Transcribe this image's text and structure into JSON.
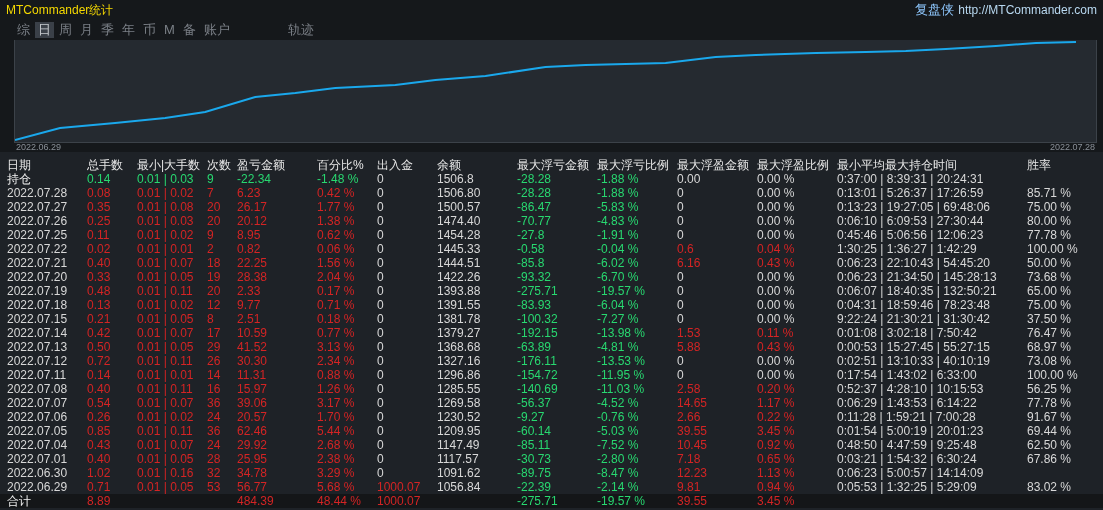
{
  "window": {
    "title": "MTCommander统计",
    "brand": "复盘侠",
    "link": "http://MTCommander.com"
  },
  "tabs": [
    {
      "label": "综",
      "selected": false
    },
    {
      "label": "日",
      "selected": true
    },
    {
      "label": "周",
      "selected": false
    },
    {
      "label": "月",
      "selected": false
    },
    {
      "label": "季",
      "selected": false
    },
    {
      "label": "年",
      "selected": false
    },
    {
      "label": "币",
      "selected": false
    },
    {
      "label": "M",
      "selected": false
    },
    {
      "label": "备",
      "selected": false
    },
    {
      "label": "账户",
      "selected": false
    },
    {
      "label": "轨迹",
      "selected": false
    }
  ],
  "chart": {
    "start_label": "2022.06.29",
    "end_label": "2022.07.28"
  },
  "table": {
    "columns": [
      "日期",
      "总手数",
      "最小|大手数",
      "次数",
      "盈亏金额",
      "百分比%",
      "出入金",
      "余额",
      "最大浮亏金额",
      "最大浮亏比例",
      "最大浮盈金额",
      "最大浮盈比例",
      "最小平均最大持仓时间",
      "胜率"
    ],
    "rows": [
      {
        "kind": "position",
        "cells": [
          {
            "text": "持仓"
          },
          {
            "text": "0.14",
            "color": "#28d870"
          },
          {
            "text": "0.01 | 0.03",
            "color": "#28d870"
          },
          {
            "text": "9",
            "color": "#28d870"
          },
          {
            "text": "-22.34",
            "color": "#28d870"
          },
          {
            "text": "-1.48 %",
            "color": "#28d870"
          },
          {
            "text": "0",
            "color": "#d8d8d8"
          },
          {
            "text": "1506.8",
            "color": "#d8d8d8"
          },
          {
            "text": "-28.28",
            "color": "#28d870"
          },
          {
            "text": "-1.88 %",
            "color": "#28d870"
          },
          {
            "text": "0.00",
            "color": "#d8d8d8"
          },
          {
            "text": "0.00 %",
            "color": "#d8d8d8"
          },
          {
            "text": "0:37:00 | 8:39:31 | 20:24:31",
            "color": "#d8d8d8"
          },
          {
            "text": ""
          }
        ]
      },
      {
        "kind": "day",
        "cells": [
          {
            "text": "2022.07.28",
            "color": "#d8d8d8"
          },
          {
            "text": "0.08",
            "color": "#d42424"
          },
          {
            "text": "0.01 | 0.02",
            "color": "#d42424"
          },
          {
            "text": "7",
            "color": "#d42424"
          },
          {
            "text": "6.23",
            "color": "#d42424"
          },
          {
            "text": "0.42 %",
            "color": "#d42424"
          },
          {
            "text": "0",
            "color": "#d8d8d8"
          },
          {
            "text": "1506.80",
            "color": "#d8d8d8"
          },
          {
            "text": "-28.28",
            "color": "#28d870"
          },
          {
            "text": "-1.88 %",
            "color": "#28d870"
          },
          {
            "text": "0",
            "color": "#d8d8d8"
          },
          {
            "text": "0.00 %",
            "color": "#d8d8d8"
          },
          {
            "text": "0:13:01 | 5:26:37 | 17:26:59",
            "color": "#d8d8d8"
          },
          {
            "text": "85.71 %",
            "color": "#d8d8d8"
          }
        ]
      },
      {
        "kind": "day",
        "cells": [
          {
            "text": "2022.07.27",
            "color": "#d8d8d8"
          },
          {
            "text": "0.35",
            "color": "#d42424"
          },
          {
            "text": "0.01 | 0.08",
            "color": "#d42424"
          },
          {
            "text": "20",
            "color": "#d42424"
          },
          {
            "text": "26.17",
            "color": "#d42424"
          },
          {
            "text": "1.77 %",
            "color": "#d42424"
          },
          {
            "text": "0",
            "color": "#d8d8d8"
          },
          {
            "text": "1500.57",
            "color": "#d8d8d8"
          },
          {
            "text": "-86.47",
            "color": "#28d870"
          },
          {
            "text": "-5.83 %",
            "color": "#28d870"
          },
          {
            "text": "0",
            "color": "#d8d8d8"
          },
          {
            "text": "0.00 %",
            "color": "#d8d8d8"
          },
          {
            "text": "0:13:23 | 19:27:05 | 69:48:06",
            "color": "#d8d8d8"
          },
          {
            "text": "75.00 %",
            "color": "#d8d8d8"
          }
        ]
      },
      {
        "kind": "day",
        "cells": [
          {
            "text": "2022.07.26",
            "color": "#d8d8d8"
          },
          {
            "text": "0.25",
            "color": "#d42424"
          },
          {
            "text": "0.01 | 0.03",
            "color": "#d42424"
          },
          {
            "text": "20",
            "color": "#d42424"
          },
          {
            "text": "20.12",
            "color": "#d42424"
          },
          {
            "text": "1.38 %",
            "color": "#d42424"
          },
          {
            "text": "0",
            "color": "#d8d8d8"
          },
          {
            "text": "1474.40",
            "color": "#d8d8d8"
          },
          {
            "text": "-70.77",
            "color": "#28d870"
          },
          {
            "text": "-4.83 %",
            "color": "#28d870"
          },
          {
            "text": "0",
            "color": "#d8d8d8"
          },
          {
            "text": "0.00 %",
            "color": "#d8d8d8"
          },
          {
            "text": "0:06:10 | 6:09:53 | 27:30:44",
            "color": "#d8d8d8"
          },
          {
            "text": "80.00 %",
            "color": "#d8d8d8"
          }
        ]
      },
      {
        "kind": "day",
        "cells": [
          {
            "text": "2022.07.25",
            "color": "#d8d8d8"
          },
          {
            "text": "0.11",
            "color": "#d42424"
          },
          {
            "text": "0.01 | 0.02",
            "color": "#d42424"
          },
          {
            "text": "9",
            "color": "#d42424"
          },
          {
            "text": "8.95",
            "color": "#d42424"
          },
          {
            "text": "0.62 %",
            "color": "#d42424"
          },
          {
            "text": "0",
            "color": "#d8d8d8"
          },
          {
            "text": "1454.28",
            "color": "#d8d8d8"
          },
          {
            "text": "-27.8",
            "color": "#28d870"
          },
          {
            "text": "-1.91 %",
            "color": "#28d870"
          },
          {
            "text": "0",
            "color": "#d8d8d8"
          },
          {
            "text": "0.00 %",
            "color": "#d8d8d8"
          },
          {
            "text": "0:45:46 | 5:06:56 | 12:06:23",
            "color": "#d8d8d8"
          },
          {
            "text": "77.78 %",
            "color": "#d8d8d8"
          }
        ]
      },
      {
        "kind": "day",
        "cells": [
          {
            "text": "2022.07.22",
            "color": "#d8d8d8"
          },
          {
            "text": "0.02",
            "color": "#d42424"
          },
          {
            "text": "0.01 | 0.01",
            "color": "#d42424"
          },
          {
            "text": "2",
            "color": "#d42424"
          },
          {
            "text": "0.82",
            "color": "#d42424"
          },
          {
            "text": "0.06 %",
            "color": "#d42424"
          },
          {
            "text": "0",
            "color": "#d8d8d8"
          },
          {
            "text": "1445.33",
            "color": "#d8d8d8"
          },
          {
            "text": "-0.58",
            "color": "#28d870"
          },
          {
            "text": "-0.04 %",
            "color": "#28d870"
          },
          {
            "text": "0.6",
            "color": "#d42424"
          },
          {
            "text": "0.04 %",
            "color": "#d42424"
          },
          {
            "text": "1:30:25 | 1:36:27 | 1:42:29",
            "color": "#d8d8d8"
          },
          {
            "text": "100.00 %",
            "color": "#d8d8d8"
          }
        ]
      },
      {
        "kind": "day",
        "cells": [
          {
            "text": "2022.07.21",
            "color": "#d8d8d8"
          },
          {
            "text": "0.40",
            "color": "#d42424"
          },
          {
            "text": "0.01 | 0.07",
            "color": "#d42424"
          },
          {
            "text": "18",
            "color": "#d42424"
          },
          {
            "text": "22.25",
            "color": "#d42424"
          },
          {
            "text": "1.56 %",
            "color": "#d42424"
          },
          {
            "text": "0",
            "color": "#d8d8d8"
          },
          {
            "text": "1444.51",
            "color": "#d8d8d8"
          },
          {
            "text": "-85.8",
            "color": "#28d870"
          },
          {
            "text": "-6.02 %",
            "color": "#28d870"
          },
          {
            "text": "6.16",
            "color": "#d42424"
          },
          {
            "text": "0.43 %",
            "color": "#d42424"
          },
          {
            "text": "0:06:23 | 22:10:43 | 54:45:20",
            "color": "#d8d8d8"
          },
          {
            "text": "50.00 %",
            "color": "#d8d8d8"
          }
        ]
      },
      {
        "kind": "day",
        "cells": [
          {
            "text": "2022.07.20",
            "color": "#d8d8d8"
          },
          {
            "text": "0.33",
            "color": "#d42424"
          },
          {
            "text": "0.01 | 0.05",
            "color": "#d42424"
          },
          {
            "text": "19",
            "color": "#d42424"
          },
          {
            "text": "28.38",
            "color": "#d42424"
          },
          {
            "text": "2.04 %",
            "color": "#d42424"
          },
          {
            "text": "0",
            "color": "#d8d8d8"
          },
          {
            "text": "1422.26",
            "color": "#d8d8d8"
          },
          {
            "text": "-93.32",
            "color": "#28d870"
          },
          {
            "text": "-6.70 %",
            "color": "#28d870"
          },
          {
            "text": "0",
            "color": "#d8d8d8"
          },
          {
            "text": "0.00 %",
            "color": "#d8d8d8"
          },
          {
            "text": "0:06:23 | 21:34:50 | 145:28:13",
            "color": "#d8d8d8"
          },
          {
            "text": "73.68 %",
            "color": "#d8d8d8"
          }
        ]
      },
      {
        "kind": "day",
        "cells": [
          {
            "text": "2022.07.19",
            "color": "#d8d8d8"
          },
          {
            "text": "0.48",
            "color": "#d42424"
          },
          {
            "text": "0.01 | 0.11",
            "color": "#d42424"
          },
          {
            "text": "20",
            "color": "#d42424"
          },
          {
            "text": "2.33",
            "color": "#d42424"
          },
          {
            "text": "0.17 %",
            "color": "#d42424"
          },
          {
            "text": "0",
            "color": "#d8d8d8"
          },
          {
            "text": "1393.88",
            "color": "#d8d8d8"
          },
          {
            "text": "-275.71",
            "color": "#28d870"
          },
          {
            "text": "-19.57 %",
            "color": "#28d870"
          },
          {
            "text": "0",
            "color": "#d8d8d8"
          },
          {
            "text": "0.00 %",
            "color": "#d8d8d8"
          },
          {
            "text": "0:06:07 | 18:40:35 | 132:50:21",
            "color": "#d8d8d8"
          },
          {
            "text": "65.00 %",
            "color": "#d8d8d8"
          }
        ]
      },
      {
        "kind": "day",
        "cells": [
          {
            "text": "2022.07.18",
            "color": "#d8d8d8"
          },
          {
            "text": "0.13",
            "color": "#d42424"
          },
          {
            "text": "0.01 | 0.02",
            "color": "#d42424"
          },
          {
            "text": "12",
            "color": "#d42424"
          },
          {
            "text": "9.77",
            "color": "#d42424"
          },
          {
            "text": "0.71 %",
            "color": "#d42424"
          },
          {
            "text": "0",
            "color": "#d8d8d8"
          },
          {
            "text": "1391.55",
            "color": "#d8d8d8"
          },
          {
            "text": "-83.93",
            "color": "#28d870"
          },
          {
            "text": "-6.04 %",
            "color": "#28d870"
          },
          {
            "text": "0",
            "color": "#d8d8d8"
          },
          {
            "text": "0.00 %",
            "color": "#d8d8d8"
          },
          {
            "text": "0:04:31 | 18:59:46 | 78:23:48",
            "color": "#d8d8d8"
          },
          {
            "text": "75.00 %",
            "color": "#d8d8d8"
          }
        ]
      },
      {
        "kind": "day",
        "cells": [
          {
            "text": "2022.07.15",
            "color": "#d8d8d8"
          },
          {
            "text": "0.21",
            "color": "#d42424"
          },
          {
            "text": "0.01 | 0.05",
            "color": "#d42424"
          },
          {
            "text": "8",
            "color": "#d42424"
          },
          {
            "text": "2.51",
            "color": "#d42424"
          },
          {
            "text": "0.18 %",
            "color": "#d42424"
          },
          {
            "text": "0",
            "color": "#d8d8d8"
          },
          {
            "text": "1381.78",
            "color": "#d8d8d8"
          },
          {
            "text": "-100.32",
            "color": "#28d870"
          },
          {
            "text": "-7.27 %",
            "color": "#28d870"
          },
          {
            "text": "0",
            "color": "#d8d8d8"
          },
          {
            "text": "0.00 %",
            "color": "#d8d8d8"
          },
          {
            "text": "9:22:24 | 21:30:21 | 31:30:42",
            "color": "#d8d8d8"
          },
          {
            "text": "37.50 %",
            "color": "#d8d8d8"
          }
        ]
      },
      {
        "kind": "day",
        "cells": [
          {
            "text": "2022.07.14",
            "color": "#d8d8d8"
          },
          {
            "text": "0.42",
            "color": "#d42424"
          },
          {
            "text": "0.01 | 0.07",
            "color": "#d42424"
          },
          {
            "text": "17",
            "color": "#d42424"
          },
          {
            "text": "10.59",
            "color": "#d42424"
          },
          {
            "text": "0.77 %",
            "color": "#d42424"
          },
          {
            "text": "0",
            "color": "#d8d8d8"
          },
          {
            "text": "1379.27",
            "color": "#d8d8d8"
          },
          {
            "text": "-192.15",
            "color": "#28d870"
          },
          {
            "text": "-13.98 %",
            "color": "#28d870"
          },
          {
            "text": "1.53",
            "color": "#d42424"
          },
          {
            "text": "0.11 %",
            "color": "#d42424"
          },
          {
            "text": "0:01:08 | 3:02:18 | 7:50:42",
            "color": "#d8d8d8"
          },
          {
            "text": "76.47 %",
            "color": "#d8d8d8"
          }
        ]
      },
      {
        "kind": "day",
        "cells": [
          {
            "text": "2022.07.13",
            "color": "#d8d8d8"
          },
          {
            "text": "0.50",
            "color": "#d42424"
          },
          {
            "text": "0.01 | 0.05",
            "color": "#d42424"
          },
          {
            "text": "29",
            "color": "#d42424"
          },
          {
            "text": "41.52",
            "color": "#d42424"
          },
          {
            "text": "3.13 %",
            "color": "#d42424"
          },
          {
            "text": "0",
            "color": "#d8d8d8"
          },
          {
            "text": "1368.68",
            "color": "#d8d8d8"
          },
          {
            "text": "-63.89",
            "color": "#28d870"
          },
          {
            "text": "-4.81 %",
            "color": "#28d870"
          },
          {
            "text": "5.88",
            "color": "#d42424"
          },
          {
            "text": "0.43 %",
            "color": "#d42424"
          },
          {
            "text": "0:00:53 | 15:27:45 | 55:27:15",
            "color": "#d8d8d8"
          },
          {
            "text": "68.97 %",
            "color": "#d8d8d8"
          }
        ]
      },
      {
        "kind": "day",
        "cells": [
          {
            "text": "2022.07.12",
            "color": "#d8d8d8"
          },
          {
            "text": "0.72",
            "color": "#d42424"
          },
          {
            "text": "0.01 | 0.11",
            "color": "#d42424"
          },
          {
            "text": "26",
            "color": "#d42424"
          },
          {
            "text": "30.30",
            "color": "#d42424"
          },
          {
            "text": "2.34 %",
            "color": "#d42424"
          },
          {
            "text": "0",
            "color": "#d8d8d8"
          },
          {
            "text": "1327.16",
            "color": "#d8d8d8"
          },
          {
            "text": "-176.11",
            "color": "#28d870"
          },
          {
            "text": "-13.53 %",
            "color": "#28d870"
          },
          {
            "text": "0",
            "color": "#d8d8d8"
          },
          {
            "text": "0.00 %",
            "color": "#d8d8d8"
          },
          {
            "text": "0:02:51 | 13:10:33 | 40:10:19",
            "color": "#d8d8d8"
          },
          {
            "text": "73.08 %",
            "color": "#d8d8d8"
          }
        ]
      },
      {
        "kind": "day",
        "cells": [
          {
            "text": "2022.07.11",
            "color": "#d8d8d8"
          },
          {
            "text": "0.14",
            "color": "#d42424"
          },
          {
            "text": "0.01 | 0.01",
            "color": "#d42424"
          },
          {
            "text": "14",
            "color": "#d42424"
          },
          {
            "text": "11.31",
            "color": "#d42424"
          },
          {
            "text": "0.88 %",
            "color": "#d42424"
          },
          {
            "text": "0",
            "color": "#d8d8d8"
          },
          {
            "text": "1296.86",
            "color": "#d8d8d8"
          },
          {
            "text": "-154.72",
            "color": "#28d870"
          },
          {
            "text": "-11.95 %",
            "color": "#28d870"
          },
          {
            "text": "0",
            "color": "#d8d8d8"
          },
          {
            "text": "0.00 %",
            "color": "#d8d8d8"
          },
          {
            "text": "0:17:54 | 1:43:02 | 6:33:00",
            "color": "#d8d8d8"
          },
          {
            "text": "100.00 %",
            "color": "#d8d8d8"
          }
        ]
      },
      {
        "kind": "day",
        "cells": [
          {
            "text": "2022.07.08",
            "color": "#d8d8d8"
          },
          {
            "text": "0.40",
            "color": "#d42424"
          },
          {
            "text": "0.01 | 0.11",
            "color": "#d42424"
          },
          {
            "text": "16",
            "color": "#d42424"
          },
          {
            "text": "15.97",
            "color": "#d42424"
          },
          {
            "text": "1.26 %",
            "color": "#d42424"
          },
          {
            "text": "0",
            "color": "#d8d8d8"
          },
          {
            "text": "1285.55",
            "color": "#d8d8d8"
          },
          {
            "text": "-140.69",
            "color": "#28d870"
          },
          {
            "text": "-11.03 %",
            "color": "#28d870"
          },
          {
            "text": "2.58",
            "color": "#d42424"
          },
          {
            "text": "0.20 %",
            "color": "#d42424"
          },
          {
            "text": "0:52:37 | 4:28:10 | 10:15:53",
            "color": "#d8d8d8"
          },
          {
            "text": "56.25 %",
            "color": "#d8d8d8"
          }
        ]
      },
      {
        "kind": "day",
        "cells": [
          {
            "text": "2022.07.07",
            "color": "#d8d8d8"
          },
          {
            "text": "0.54",
            "color": "#d42424"
          },
          {
            "text": "0.01 | 0.07",
            "color": "#d42424"
          },
          {
            "text": "36",
            "color": "#d42424"
          },
          {
            "text": "39.06",
            "color": "#d42424"
          },
          {
            "text": "3.17 %",
            "color": "#d42424"
          },
          {
            "text": "0",
            "color": "#d8d8d8"
          },
          {
            "text": "1269.58",
            "color": "#d8d8d8"
          },
          {
            "text": "-56.37",
            "color": "#28d870"
          },
          {
            "text": "-4.52 %",
            "color": "#28d870"
          },
          {
            "text": "14.65",
            "color": "#d42424"
          },
          {
            "text": "1.17 %",
            "color": "#d42424"
          },
          {
            "text": "0:06:29 | 1:43:53 | 6:14:22",
            "color": "#d8d8d8"
          },
          {
            "text": "77.78 %",
            "color": "#d8d8d8"
          }
        ]
      },
      {
        "kind": "day",
        "cells": [
          {
            "text": "2022.07.06",
            "color": "#d8d8d8"
          },
          {
            "text": "0.26",
            "color": "#d42424"
          },
          {
            "text": "0.01 | 0.02",
            "color": "#d42424"
          },
          {
            "text": "24",
            "color": "#d42424"
          },
          {
            "text": "20.57",
            "color": "#d42424"
          },
          {
            "text": "1.70 %",
            "color": "#d42424"
          },
          {
            "text": "0",
            "color": "#d8d8d8"
          },
          {
            "text": "1230.52",
            "color": "#d8d8d8"
          },
          {
            "text": "-9.27",
            "color": "#28d870"
          },
          {
            "text": "-0.76 %",
            "color": "#28d870"
          },
          {
            "text": "2.66",
            "color": "#d42424"
          },
          {
            "text": "0.22 %",
            "color": "#d42424"
          },
          {
            "text": "0:11:28 | 1:59:21 | 7:00:28",
            "color": "#d8d8d8"
          },
          {
            "text": "91.67 %",
            "color": "#d8d8d8"
          }
        ]
      },
      {
        "kind": "day",
        "cells": [
          {
            "text": "2022.07.05",
            "color": "#d8d8d8"
          },
          {
            "text": "0.85",
            "color": "#d42424"
          },
          {
            "text": "0.01 | 0.11",
            "color": "#d42424"
          },
          {
            "text": "36",
            "color": "#d42424"
          },
          {
            "text": "62.46",
            "color": "#d42424"
          },
          {
            "text": "5.44 %",
            "color": "#d42424"
          },
          {
            "text": "0",
            "color": "#d8d8d8"
          },
          {
            "text": "1209.95",
            "color": "#d8d8d8"
          },
          {
            "text": "-60.14",
            "color": "#28d870"
          },
          {
            "text": "-5.03 %",
            "color": "#28d870"
          },
          {
            "text": "39.55",
            "color": "#d42424"
          },
          {
            "text": "3.45 %",
            "color": "#d42424"
          },
          {
            "text": "0:01:54 | 5:00:19 | 20:01:23",
            "color": "#d8d8d8"
          },
          {
            "text": "69.44 %",
            "color": "#d8d8d8"
          }
        ]
      },
      {
        "kind": "day",
        "cells": [
          {
            "text": "2022.07.04",
            "color": "#d8d8d8"
          },
          {
            "text": "0.43",
            "color": "#d42424"
          },
          {
            "text": "0.01 | 0.07",
            "color": "#d42424"
          },
          {
            "text": "24",
            "color": "#d42424"
          },
          {
            "text": "29.92",
            "color": "#d42424"
          },
          {
            "text": "2.68 %",
            "color": "#d42424"
          },
          {
            "text": "0",
            "color": "#d8d8d8"
          },
          {
            "text": "1147.49",
            "color": "#d8d8d8"
          },
          {
            "text": "-85.11",
            "color": "#28d870"
          },
          {
            "text": "-7.52 %",
            "color": "#28d870"
          },
          {
            "text": "10.45",
            "color": "#d42424"
          },
          {
            "text": "0.92 %",
            "color": "#d42424"
          },
          {
            "text": "0:48:50 | 4:47:59 | 9:25:48",
            "color": "#d8d8d8"
          },
          {
            "text": "62.50 %",
            "color": "#d8d8d8"
          }
        ]
      },
      {
        "kind": "day",
        "cells": [
          {
            "text": "2022.07.01",
            "color": "#d8d8d8"
          },
          {
            "text": "0.40",
            "color": "#d42424"
          },
          {
            "text": "0.01 | 0.05",
            "color": "#d42424"
          },
          {
            "text": "28",
            "color": "#d42424"
          },
          {
            "text": "25.95",
            "color": "#d42424"
          },
          {
            "text": "2.38 %",
            "color": "#d42424"
          },
          {
            "text": "0",
            "color": "#d8d8d8"
          },
          {
            "text": "1117.57",
            "color": "#d8d8d8"
          },
          {
            "text": "-30.73",
            "color": "#28d870"
          },
          {
            "text": "-2.80 %",
            "color": "#28d870"
          },
          {
            "text": "7.18",
            "color": "#d42424"
          },
          {
            "text": "0.65 %",
            "color": "#d42424"
          },
          {
            "text": "0:03:21 | 1:54:32 | 6:30:24",
            "color": "#d8d8d8"
          },
          {
            "text": "67.86 %",
            "color": "#d8d8d8"
          }
        ]
      },
      {
        "kind": "day",
        "cells": [
          {
            "text": "2022.06.30",
            "color": "#d8d8d8"
          },
          {
            "text": "1.02",
            "color": "#d42424"
          },
          {
            "text": "0.01 | 0.16",
            "color": "#d42424"
          },
          {
            "text": "32",
            "color": "#d42424"
          },
          {
            "text": "34.78",
            "color": "#d42424"
          },
          {
            "text": "3.29 %",
            "color": "#d42424"
          },
          {
            "text": "0",
            "color": "#d8d8d8"
          },
          {
            "text": "1091.62",
            "color": "#d8d8d8"
          },
          {
            "text": "-89.75",
            "color": "#28d870"
          },
          {
            "text": "-8.47 %",
            "color": "#28d870"
          },
          {
            "text": "12.23",
            "color": "#d42424"
          },
          {
            "text": "1.13 %",
            "color": "#d42424"
          },
          {
            "text": "0:06:23 | 5:00:57 | 14:14:09",
            "color": "#d8d8d8"
          },
          {
            "text": ""
          }
        ]
      },
      {
        "kind": "day",
        "cells": [
          {
            "text": "2022.06.29",
            "color": "#d8d8d8"
          },
          {
            "text": "0.71",
            "color": "#d42424"
          },
          {
            "text": "0.01 | 0.05",
            "color": "#d42424"
          },
          {
            "text": "53",
            "color": "#d42424"
          },
          {
            "text": "56.77",
            "color": "#d42424"
          },
          {
            "text": "5.68 %",
            "color": "#d42424"
          },
          {
            "text": "1000.07",
            "color": "#d42424"
          },
          {
            "text": "1056.84",
            "color": "#d8d8d8"
          },
          {
            "text": "-22.39",
            "color": "#28d870"
          },
          {
            "text": "-2.14 %",
            "color": "#28d870"
          },
          {
            "text": "9.81",
            "color": "#d42424"
          },
          {
            "text": "0.94 %",
            "color": "#d42424"
          },
          {
            "text": "0:05:53 | 1:32:25 | 5:29:09",
            "color": "#d8d8d8"
          },
          {
            "text": "83.02 %",
            "color": "#d8d8d8"
          }
        ]
      },
      {
        "kind": "total",
        "cells": [
          {
            "text": "合计"
          },
          {
            "text": "8.89",
            "color": "#d42424"
          },
          {
            "text": ""
          },
          {
            "text": ""
          },
          {
            "text": "484.39",
            "color": "#d42424"
          },
          {
            "text": "48.44 %",
            "color": "#d42424"
          },
          {
            "text": "1000.07",
            "color": "#d42424"
          },
          {
            "text": ""
          },
          {
            "text": "-275.71",
            "color": "#28d870"
          },
          {
            "text": "-19.57 %",
            "color": "#28d870"
          },
          {
            "text": "39.55",
            "color": "#d42424"
          },
          {
            "text": "3.45 %",
            "color": "#d42424"
          },
          {
            "text": ""
          },
          {
            "text": ""
          }
        ]
      }
    ]
  }
}
